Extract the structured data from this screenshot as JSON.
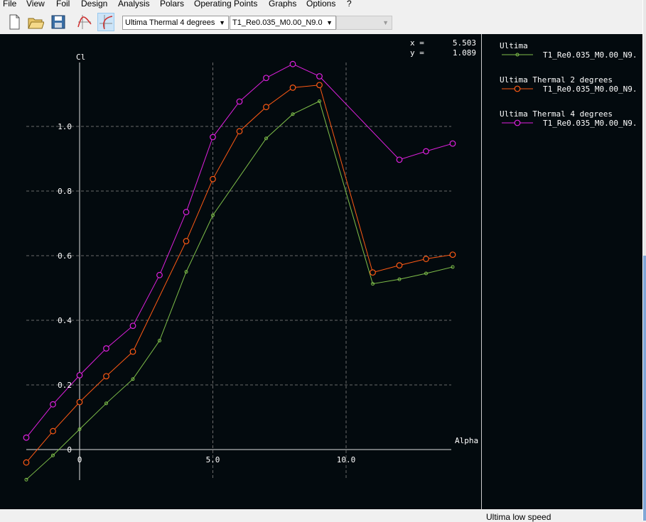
{
  "menu": [
    "File",
    "View",
    "Foil",
    "Design",
    "Analysis",
    "Polars",
    "Operating Points",
    "Graphs",
    "Options",
    "?"
  ],
  "toolbar": {
    "foil_select": "Ultima Thermal 4 degrees",
    "polar_select": "T1_Re0.035_M0.00_N9.0",
    "opp_select": ""
  },
  "readout": {
    "x_label": "x =",
    "x_value": "5.503",
    "y_label": "y =",
    "y_value": "1.089"
  },
  "status_text": "Ultima low speed",
  "chart_data": {
    "type": "line",
    "xlabel": "Alpha",
    "ylabel": "Cl",
    "xlim": [
      -2,
      14
    ],
    "ylim": [
      -0.1,
      1.2
    ],
    "x_ticks": [
      0,
      5,
      10
    ],
    "x_tick_labels": [
      "0",
      "5.0",
      "10.0"
    ],
    "y_ticks": [
      0,
      0.2,
      0.4,
      0.6,
      0.8,
      1.0
    ],
    "y_tick_labels": [
      "0",
      "0.2",
      "0.4",
      "0.6",
      "0.8",
      "1.0"
    ],
    "grid": true,
    "series": [
      {
        "foil": "Ultima",
        "name": "T1_Re0.035_M0.00_N9.",
        "color": "#7fbf4a",
        "marker": "dot",
        "x": [
          -2,
          -1,
          0,
          1,
          2,
          3,
          4,
          5,
          7,
          8,
          9,
          11,
          12,
          13,
          14
        ],
        "y": [
          -0.093,
          -0.018,
          0.063,
          0.143,
          0.218,
          0.337,
          0.55,
          0.725,
          0.963,
          1.038,
          1.078,
          0.513,
          0.527,
          0.545,
          0.565
        ]
      },
      {
        "foil": "Ultima Thermal 2 degrees",
        "name": "T1_Re0.035_M0.00_N9.",
        "color": "#ff5a14",
        "marker": "circle",
        "x": [
          -2,
          -1,
          0,
          1,
          2,
          4,
          5,
          6,
          7,
          8,
          9,
          11,
          12,
          13,
          14
        ],
        "y": [
          -0.04,
          0.057,
          0.147,
          0.227,
          0.303,
          0.645,
          0.837,
          0.985,
          1.06,
          1.12,
          1.128,
          0.548,
          0.57,
          0.59,
          0.603
        ]
      },
      {
        "foil": "Ultima Thermal 4 degrees",
        "name": "T1_Re0.035_M0.00_N9.",
        "color": "#e020e0",
        "marker": "circle",
        "x": [
          -2,
          -1,
          0,
          1,
          2,
          3,
          4,
          5,
          6,
          7,
          8,
          9,
          12,
          13,
          14
        ],
        "y": [
          0.037,
          0.14,
          0.23,
          0.313,
          0.383,
          0.54,
          0.735,
          0.967,
          1.077,
          1.15,
          1.193,
          1.155,
          0.897,
          0.923,
          0.947
        ]
      }
    ]
  }
}
